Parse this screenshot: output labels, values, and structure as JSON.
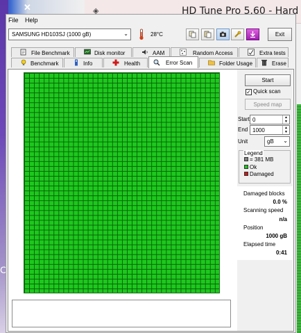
{
  "background": {
    "window_title": "HD Tune Pro 5.60 - Hard"
  },
  "menu": {
    "file": "File",
    "help": "Help"
  },
  "toolbar": {
    "drive": "SAMSUNG HD103SJ (1000 gB)",
    "temperature": "28°C",
    "exit_label": "Exit",
    "buttons": [
      "copy-text",
      "copy-screenshot",
      "save-screenshot",
      "options",
      "download"
    ]
  },
  "tabs": {
    "row1": [
      {
        "label": "File Benchmark",
        "icon": "file-benchmark-icon"
      },
      {
        "label": "Disk monitor",
        "icon": "disk-monitor-icon"
      },
      {
        "label": "AAM",
        "icon": "speaker-icon"
      },
      {
        "label": "Random Access",
        "icon": "random-access-icon"
      },
      {
        "label": "Extra tests",
        "icon": "extra-tests-icon"
      }
    ],
    "row2": [
      {
        "label": "Benchmark",
        "icon": "lightbulb-icon"
      },
      {
        "label": "Info",
        "icon": "info-icon"
      },
      {
        "label": "Health",
        "icon": "health-cross-icon"
      },
      {
        "label": "Error Scan",
        "icon": "magnifier-icon"
      },
      {
        "label": "Folder Usage",
        "icon": "folder-icon"
      },
      {
        "label": "Erase",
        "icon": "trash-icon"
      }
    ],
    "active": "Error Scan"
  },
  "scan": {
    "start_label": "Start",
    "quick_scan_label": "Quick scan",
    "quick_scan_checked": true,
    "speed_map_label": "Speed map",
    "start_field_label": "Start",
    "start_value": "0",
    "end_field_label": "End",
    "end_value": "1000",
    "unit_label": "Unit",
    "unit_value": "gB"
  },
  "legend": {
    "title": "Legend",
    "block_size": "= 381 MB",
    "ok": "Ok",
    "damaged": "Damaged"
  },
  "stats": {
    "damaged_blocks_label": "Damaged blocks",
    "damaged_blocks_value": "0.0 %",
    "scanning_speed_label": "Scanning speed",
    "scanning_speed_value": "n/a",
    "position_label": "Position",
    "position_value": "1000 gB",
    "elapsed_label": "Elapsed time",
    "elapsed_value": "0:41"
  },
  "colors": {
    "block_ok": "#1cc91c",
    "block_grid": "#0d5f0d",
    "damaged": "#d01818",
    "legend_block": "#808080"
  }
}
